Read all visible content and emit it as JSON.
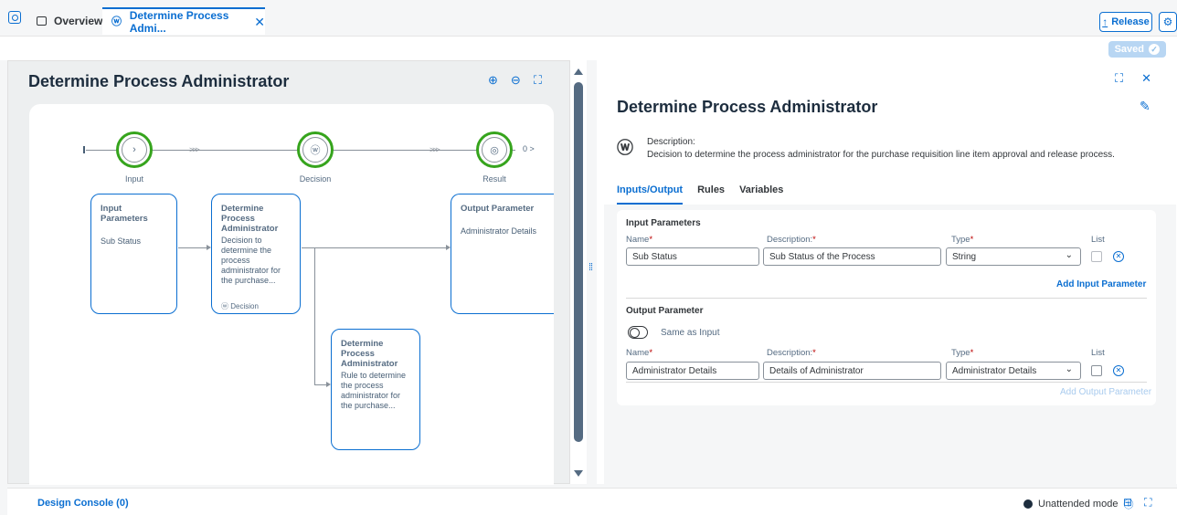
{
  "tabs": {
    "overview_label": "Overview",
    "active_label": "Determine Process Admi...",
    "close_glyph": "✕"
  },
  "toolbar": {
    "release_label": "Release",
    "saved_label": "Saved"
  },
  "canvas": {
    "title": "Determine Process Administrator",
    "nodes": [
      {
        "label": "Input",
        "icon": "chevron-right-icon"
      },
      {
        "label": "Decision",
        "icon": "decision-icon"
      },
      {
        "label": "Result",
        "icon": "target-icon"
      }
    ],
    "end_marker": "0 >",
    "cards": {
      "input": {
        "title": "Input Parameters",
        "body": "Sub Status"
      },
      "decision": {
        "title": "Determine Process Administrator",
        "body": "Decision to determine the process administrator for the purchase...",
        "footer": "Decision"
      },
      "output": {
        "title": "Output Parameter",
        "body": "Administrator Details"
      },
      "rule": {
        "title": "Determine Process Administrator",
        "body": "Rule to determine the process administrator for the purchase..."
      }
    }
  },
  "detail": {
    "title": "Determine Process Administrator",
    "description_label": "Description:",
    "description_text": "Decision to determine the process administrator for the purchase requisition line item approval and release process.",
    "tabs": [
      "Inputs/Output",
      "Rules",
      "Variables"
    ],
    "active_tab": "Inputs/Output",
    "input_section": {
      "title": "Input Parameters",
      "col_name": "Name",
      "col_desc": "Description:",
      "col_type": "Type",
      "col_list": "List",
      "row": {
        "name": "Sub Status",
        "description": "Sub Status of the Process",
        "type": "String",
        "list": false
      },
      "add_label": "Add Input Parameter"
    },
    "output_section": {
      "title": "Output Parameter",
      "toggle_label": "Same as Input",
      "col_name": "Name",
      "col_desc": "Description:",
      "col_type": "Type",
      "col_list": "List",
      "row": {
        "name": "Administrator Details",
        "description": "Details of Administrator",
        "type": "Administrator Details",
        "list": false
      },
      "add_label": "Add Output Parameter"
    }
  },
  "footer": {
    "console_label": "Design Console (0)",
    "mode_label": "Unattended mode"
  },
  "colors": {
    "accent": "#0a6ed1",
    "success": "#36a41d",
    "required": "#bb0000"
  }
}
